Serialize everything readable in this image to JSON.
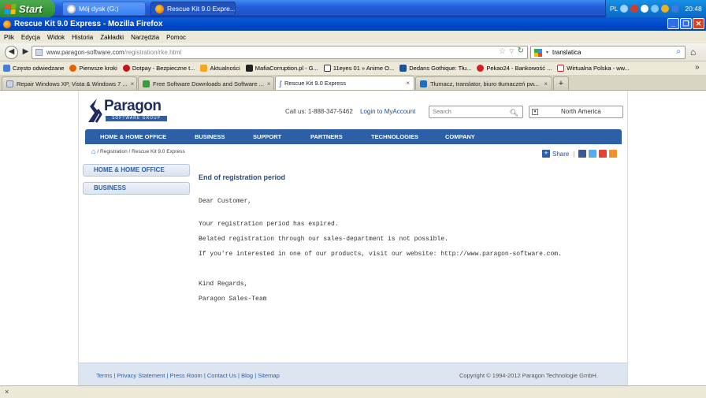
{
  "taskbar": {
    "start_label": "Start",
    "tasks": [
      {
        "label": "Mój dysk (G:)"
      },
      {
        "label": "Rescue Kit 9.0 Expre..."
      }
    ],
    "tray": {
      "lang": "PL",
      "time": "20:48"
    }
  },
  "window": {
    "title": "Rescue Kit 9.0 Express - Mozilla Firefox"
  },
  "menu": [
    "Plik",
    "Edycja",
    "Widok",
    "Historia",
    "Zakładki",
    "Narzędzia",
    "Pomoc"
  ],
  "navbar": {
    "url_host": "www.paragon-software.com",
    "url_path": "/registration/rke.html",
    "search_engine_text": "translatica"
  },
  "bookmarks": [
    {
      "label": "Często odwiedzane"
    },
    {
      "label": "Pierwsze kroki"
    },
    {
      "label": "Dotpay - Bezpieczne t..."
    },
    {
      "label": "Aktualności"
    },
    {
      "label": "MafiaCorruption.pl - G..."
    },
    {
      "label": "11eyes 01 » Anime O..."
    },
    {
      "label": "Dedans Gothique: Tłu..."
    },
    {
      "label": "Pekao24 - Bankowość ..."
    },
    {
      "label": "Wirtualna Polska - ww..."
    }
  ],
  "tabs": [
    {
      "label": "Repair Windows XP, Vista & Windows 7 ..."
    },
    {
      "label": "Free Software Downloads and Software ..."
    },
    {
      "label": "Rescue Kit 9.0 Express"
    },
    {
      "label": "Tłumacz, translator, biuro tłumaczeń pw..."
    }
  ],
  "site": {
    "logo_text": "Paragon",
    "logo_sub": "SOFTWARE GROUP",
    "call_us": "Call us: 1-888-347-5462",
    "login": "Login to MyAccount",
    "search_placeholder": "Search",
    "region": "North America",
    "nav": [
      "HOME & HOME OFFICE",
      "BUSINESS",
      "SUPPORT",
      "PARTNERS",
      "TECHNOLOGIES",
      "COMPANY"
    ],
    "breadcrumb": "/ Registration / Rescue Kit 9.0 Express",
    "share": "Share",
    "side": [
      "HOME & HOME OFFICE",
      "BUSINESS"
    ],
    "heading": "End of registration period",
    "body": [
      "Dear Customer,",
      "Your registration period has expired.",
      "Belated registration through our sales-department is not possible.",
      "If you're interested in one of our products, visit our website: http://www.paragon-software.com.",
      "Kind Regards,",
      "Paragon Sales-Team"
    ],
    "footer_links": "Terms | Privacy Statement | Press Room | Contact Us | Blog | Sitemap",
    "copyright": "Copyright © 1994-2012 Paragon Technologie GmbH."
  },
  "statusbar": {
    "close_label": "×"
  }
}
